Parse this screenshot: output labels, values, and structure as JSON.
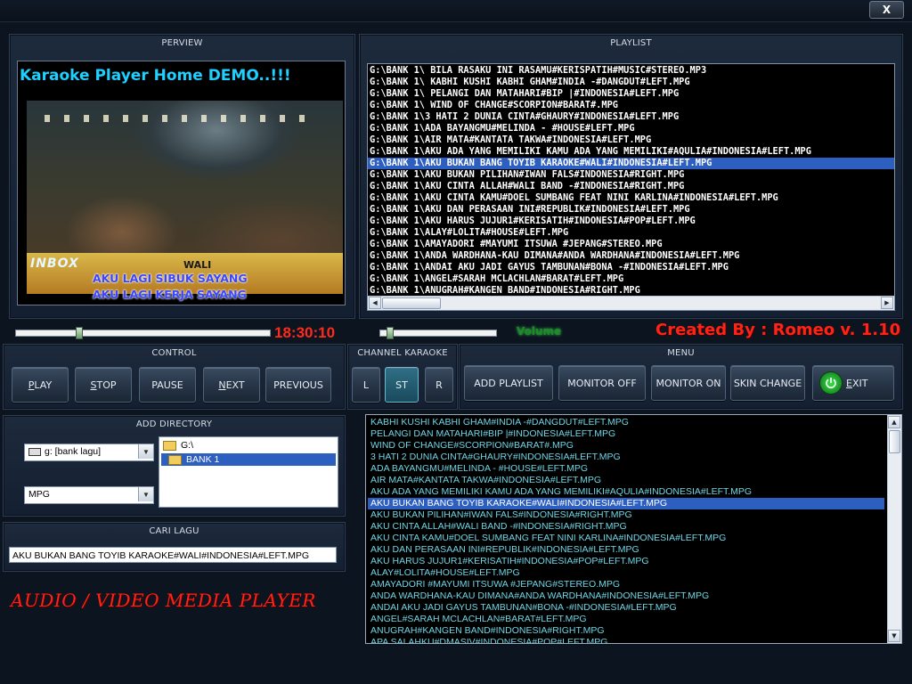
{
  "window": {
    "close_label": "X"
  },
  "preview": {
    "title": "PERVIEW",
    "overlay_title": "Karaoke Player Home DEMO..!!!",
    "logo_text": "INBOX",
    "artist_text": "WALI",
    "lyric_line_1": "AKU LAGI SIBUK SAYANG",
    "lyric_line_2": "AKU LAGI KERJA SAYANG",
    "seek_fraction": 0.24,
    "time": "18:30:10"
  },
  "playlist": {
    "title": "PLAYLIST",
    "selected_index": 8,
    "items": [
      "G:\\BANK 1\\ BILA RASAKU INI RASAMU#KERISPATIH#MUSIC#STEREO.MP3",
      "G:\\BANK 1\\ KABHI KUSHI KABHI GHAM#INDIA -#DANGDUT#LEFT.MPG",
      "G:\\BANK 1\\ PELANGI DAN MATAHARI#BIP |#INDONESIA#LEFT.MPG",
      "G:\\BANK 1\\ WIND OF CHANGE#SCORPION#BARAT#.MPG",
      "G:\\BANK 1\\3 HATI 2 DUNIA CINTA#GHAURY#INDONESIA#LEFT.MPG",
      "G:\\BANK 1\\ADA BAYANGMU#MELINDA - #HOUSE#LEFT.MPG",
      "G:\\BANK 1\\AIR MATA#KANTATA TAKWA#INDONESIA#LEFT.MPG",
      "G:\\BANK 1\\AKU ADA YANG MEMILIKI KAMU ADA YANG MEMILIKI#AQULIA#INDONESIA#LEFT.MPG",
      "G:\\BANK 1\\AKU BUKAN BANG TOYIB KARAOKE#WALI#INDONESIA#LEFT.MPG",
      "G:\\BANK 1\\AKU BUKAN PILIHAN#IWAN FALS#INDONESIA#RIGHT.MPG",
      "G:\\BANK 1\\AKU CINTA ALLAH#WALI BAND -#INDONESIA#RIGHT.MPG",
      "G:\\BANK 1\\AKU CINTA KAMU#DOEL SUMBANG FEAT NINI KARLINA#INDONESIA#LEFT.MPG",
      "G:\\BANK 1\\AKU DAN PERASAAN INI#REPUBLIK#INDONESIA#LEFT.MPG",
      "G:\\BANK 1\\AKU HARUS JUJUR1#KERISATIH#INDONESIA#POP#LEFT.MPG",
      "G:\\BANK 1\\ALAY#LOLITA#HOUSE#LEFT.MPG",
      "G:\\BANK 1\\AMAYADORI #MAYUMI ITSUWA #JEPANG#STEREO.MPG",
      "G:\\BANK 1\\ANDA WARDHANA-KAU DIMANA#ANDA WARDHANA#INDONESIA#LEFT.MPG",
      "G:\\BANK 1\\ANDAI AKU JADI GAYUS TAMBUNAN#BONA -#INDONESIA#LEFT.MPG",
      "G:\\BANK 1\\ANGEL#SARAH MCLACHLAN#BARAT#LEFT.MPG",
      "G:\\BANK 1\\ANUGRAH#KANGEN BAND#INDONESIA#RIGHT.MPG"
    ]
  },
  "volume": {
    "label": "Volume",
    "fraction": 0.06
  },
  "credit": "Created By : Romeo v. 1.10",
  "control": {
    "title": "CONTROL",
    "play": {
      "ul": "P",
      "rest": "LAY"
    },
    "stop": {
      "ul": "S",
      "rest": "TOP"
    },
    "pause": "PAUSE",
    "next": {
      "ul": "N",
      "rest": "EXT"
    },
    "previous": "PREVIOUS"
  },
  "channel": {
    "title": "CHANNEL KARAOKE",
    "left": "L",
    "stereo": "ST",
    "right": "R",
    "active": "ST"
  },
  "menu": {
    "title": "MENU",
    "add_playlist": "ADD PLAYLIST",
    "monitor_off": "MONITOR OFF",
    "monitor_on": "MONITOR ON",
    "skin_change": "SKIN CHANGE",
    "exit": {
      "ul": "E",
      "rest": "XIT"
    }
  },
  "add_directory": {
    "title": "ADD DIRECTORY",
    "drive_value": "g: [bank lagu]",
    "filetype_value": "MPG",
    "tree": [
      "G:\\",
      "BANK 1"
    ],
    "tree_selected": 1
  },
  "search": {
    "title": "CARI LAGU",
    "value": "AKU BUKAN BANG TOYIB KARAOKE#WALI#INDONESIA#LEFT.MPG"
  },
  "brand_banner": "AUDIO / VIDEO MEDIA PLAYER",
  "files": {
    "selected_index": 7,
    "items": [
      " KABHI KUSHI KABHI GHAM#INDIA -#DANGDUT#LEFT.MPG",
      " PELANGI DAN MATAHARI#BIP |#INDONESIA#LEFT.MPG",
      " WIND OF CHANGE#SCORPION#BARAT#.MPG",
      "3 HATI 2 DUNIA CINTA#GHAURY#INDONESIA#LEFT.MPG",
      "ADA BAYANGMU#MELINDA - #HOUSE#LEFT.MPG",
      "AIR MATA#KANTATA TAKWA#INDONESIA#LEFT.MPG",
      "AKU ADA YANG MEMILIKI KAMU ADA YANG MEMILIKI#AQULIA#INDONESIA#LEFT.MPG",
      "AKU BUKAN BANG TOYIB KARAOKE#WALI#INDONESIA#LEFT.MPG",
      "AKU BUKAN PILIHAN#IWAN FALS#INDONESIA#RIGHT.MPG",
      "AKU CINTA ALLAH#WALI BAND -#INDONESIA#RIGHT.MPG",
      "AKU CINTA KAMU#DOEL SUMBANG FEAT NINI KARLINA#INDONESIA#LEFT.MPG",
      "AKU DAN PERASAAN INI#REPUBLIK#INDONESIA#LEFT.MPG",
      "AKU HARUS JUJUR1#KERISATIH#INDONESIA#POP#LEFT.MPG",
      "ALAY#LOLITA#HOUSE#LEFT.MPG",
      "AMAYADORI #MAYUMI ITSUWA #JEPANG#STEREO.MPG",
      "ANDA WARDHANA-KAU DIMANA#ANDA WARDHANA#INDONESIA#LEFT.MPG",
      "ANDAI AKU JADI GAYUS TAMBUNAN#BONA -#INDONESIA#LEFT.MPG",
      "ANGEL#SARAH MCLACHLAN#BARAT#LEFT.MPG",
      "ANUGRAH#KANGEN BAND#INDONESIA#RIGHT.MPG",
      "APA SALAHKU#DMASIV#INDONESIA#POP#LEFT.MPG"
    ]
  },
  "colors": {
    "accent_red": "#e0201a",
    "selection_blue": "#2c5fbf",
    "file_text_cyan": "#6fd6e6",
    "volume_green": "#1f8a2a"
  }
}
